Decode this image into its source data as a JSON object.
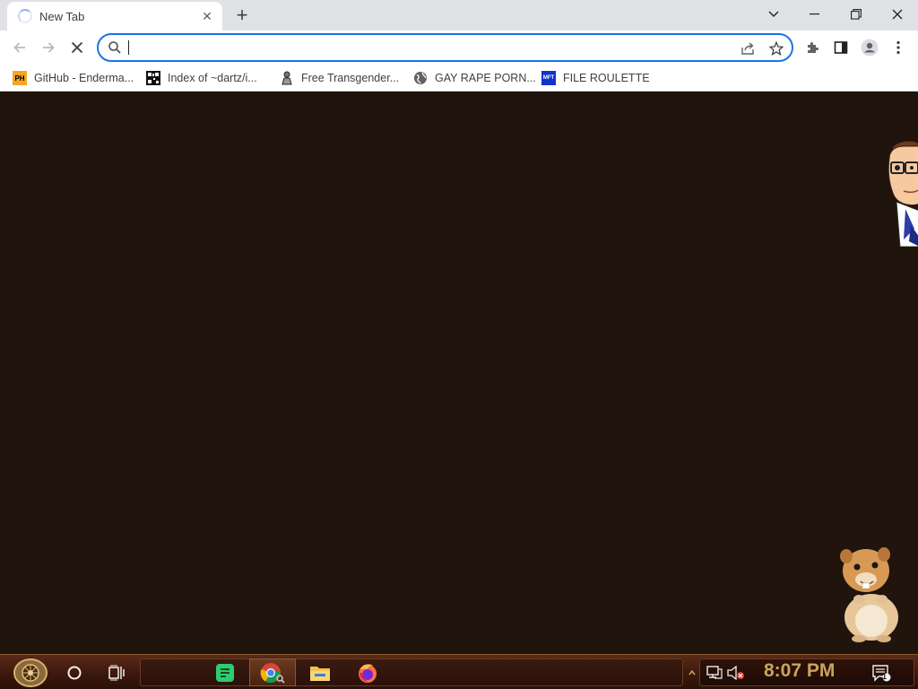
{
  "browser": {
    "tab": {
      "title": "New Tab"
    },
    "omnibox": {
      "value": "",
      "placeholder": ""
    }
  },
  "bookmarks": [
    {
      "label": "GitHub - Enderma...",
      "icon": "ph-favicon"
    },
    {
      "label": "Index of ~dartz/i...",
      "icon": "qr-favicon"
    },
    {
      "label": "Free Transgender...",
      "icon": "figure-favicon"
    },
    {
      "label": "GAY RAPE PORN...",
      "icon": "globe-favicon"
    },
    {
      "label": "FILE ROULETTE",
      "icon": "mft-favicon"
    }
  ],
  "favicon_text": {
    "ph": "PH",
    "mft": "MFT"
  },
  "taskbar": {
    "clock": "8:07 PM",
    "notification_count": "1",
    "apps": [
      "start-orb",
      "cortana",
      "task-view",
      "spotify-like",
      "chrome",
      "file-explorer",
      "firefox"
    ]
  },
  "colors": {
    "accent": "#1a73e8",
    "page_bg": "#20140d",
    "clock": "#c9a45a"
  }
}
